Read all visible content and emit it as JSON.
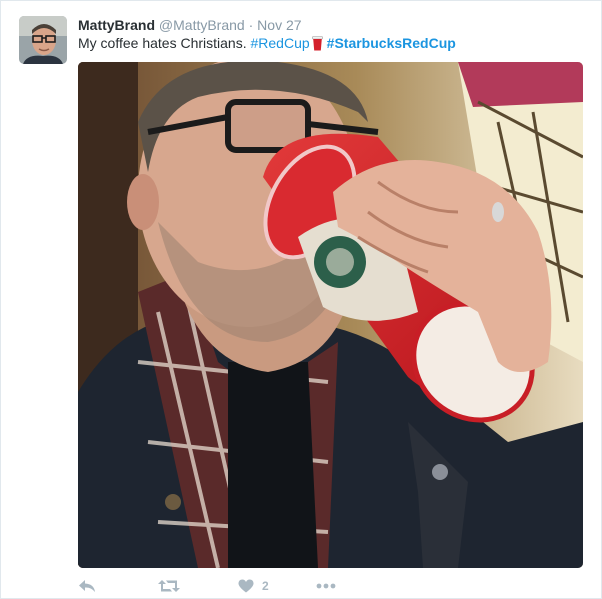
{
  "tweet": {
    "name": "MattyBrand",
    "handle": "@MattyBrand",
    "separator": "·",
    "time": "Nov 27",
    "text_plain": "My coffee hates Christians.",
    "hashtag_1": "#RedCup",
    "hashtag_2": "#StarbucksRedCup",
    "emoji": "red-coffee-cup",
    "media_description_icon": "photo",
    "like_count": "2"
  },
  "actions": {
    "reply_icon": "reply-icon",
    "retweet_icon": "retweet-icon",
    "like_icon": "heart-icon",
    "more_icon": "more-icon"
  },
  "colors": {
    "name": "#292f33",
    "meta": "#8899a6",
    "link": "#1b95e0",
    "action": "#aab8c2",
    "border": "#e1e8ed"
  }
}
